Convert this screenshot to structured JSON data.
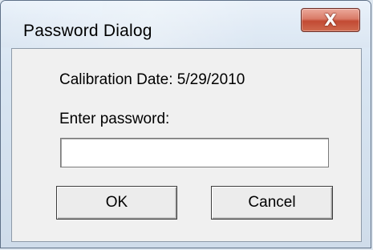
{
  "window": {
    "title": "Password Dialog",
    "close_label": "X"
  },
  "dialog": {
    "calibration_text": "Calibration Date: 5/29/2010",
    "password_label": "Enter password:",
    "password_value": "",
    "ok_label": "OK",
    "cancel_label": "Cancel"
  }
}
